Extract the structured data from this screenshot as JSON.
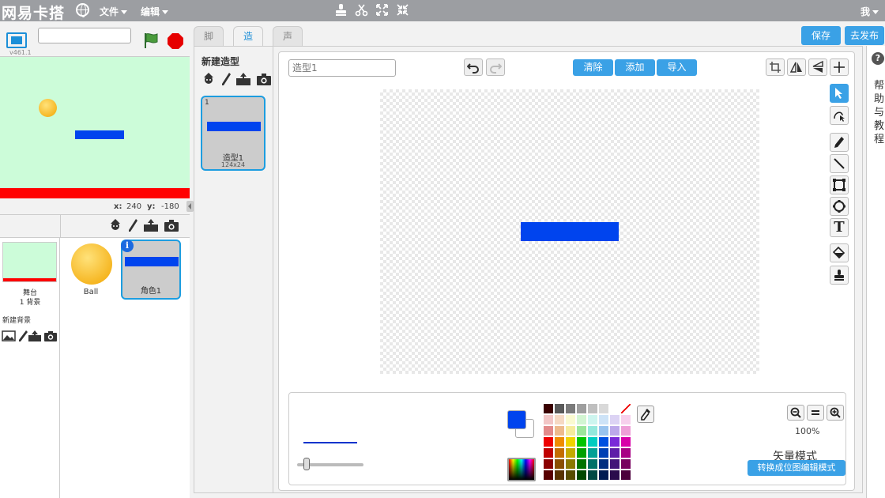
{
  "menubar": {
    "logo": "网易卡搭",
    "file_menu": "文件",
    "edit_menu": "编辑",
    "user_menu": "我"
  },
  "stage": {
    "version": "v461.1",
    "project_title": "",
    "coord_x_label": "x:",
    "coord_x": "240",
    "coord_y_label": "y:",
    "coord_y": "-180",
    "background_color": "#ccfcd9"
  },
  "sprites_pane": {
    "stage_name": "舞台",
    "stage_backdrops": "1 背景",
    "new_backdrop_label": "新建背景",
    "sprites": [
      {
        "name": "Ball"
      },
      {
        "name": "角色1"
      }
    ]
  },
  "editor": {
    "tabs": [
      "脚本",
      "造型",
      "声音"
    ],
    "active_tab": "造型",
    "save_label": "保存",
    "publish_label": "去发布",
    "new_costume_label": "新建造型",
    "costume": {
      "index": "1",
      "name": "造型1",
      "size": "124x24"
    },
    "costume_name_input": "造型1",
    "clear_label": "清除",
    "add_label": "添加",
    "import_label": "导入",
    "zoom_level": "100%",
    "mode_label": "矢量模式",
    "convert_label": "转换成位图编辑模式",
    "fill_color": "#0044ee"
  },
  "palette": [
    "#3a0000",
    "#595959",
    "#7a7a7a",
    "#9e9e9e",
    "#bfbfbf",
    "#d9d9d9",
    "#ffffff",
    "none",
    "#f2c6c6",
    "#f6d9c3",
    "#fafad0",
    "#d2f5d2",
    "#cdf5ef",
    "#cde3f7",
    "#dcd3f4",
    "#f6d0ec",
    "#e28a8a",
    "#edba8c",
    "#f5eb9c",
    "#9be59b",
    "#93e8dc",
    "#98c3ee",
    "#bca8ea",
    "#ee9ed7",
    "#ee0000",
    "#ef8c00",
    "#efd300",
    "#00c400",
    "#00ccc0",
    "#0050e0",
    "#7a2ad8",
    "#d800a8",
    "#c00000",
    "#c46d00",
    "#c4aa00",
    "#00a000",
    "#00a096",
    "#0040b4",
    "#5e1ea8",
    "#a80084",
    "#8a0000",
    "#8a4e00",
    "#8a7800",
    "#007200",
    "#007068",
    "#002e80",
    "#421478",
    "#78005e",
    "#580000",
    "#583200",
    "#584c00",
    "#004800",
    "#004844",
    "#001c52",
    "#2a0c4c",
    "#4c003c"
  ],
  "help": {
    "label": "帮助与教程"
  }
}
